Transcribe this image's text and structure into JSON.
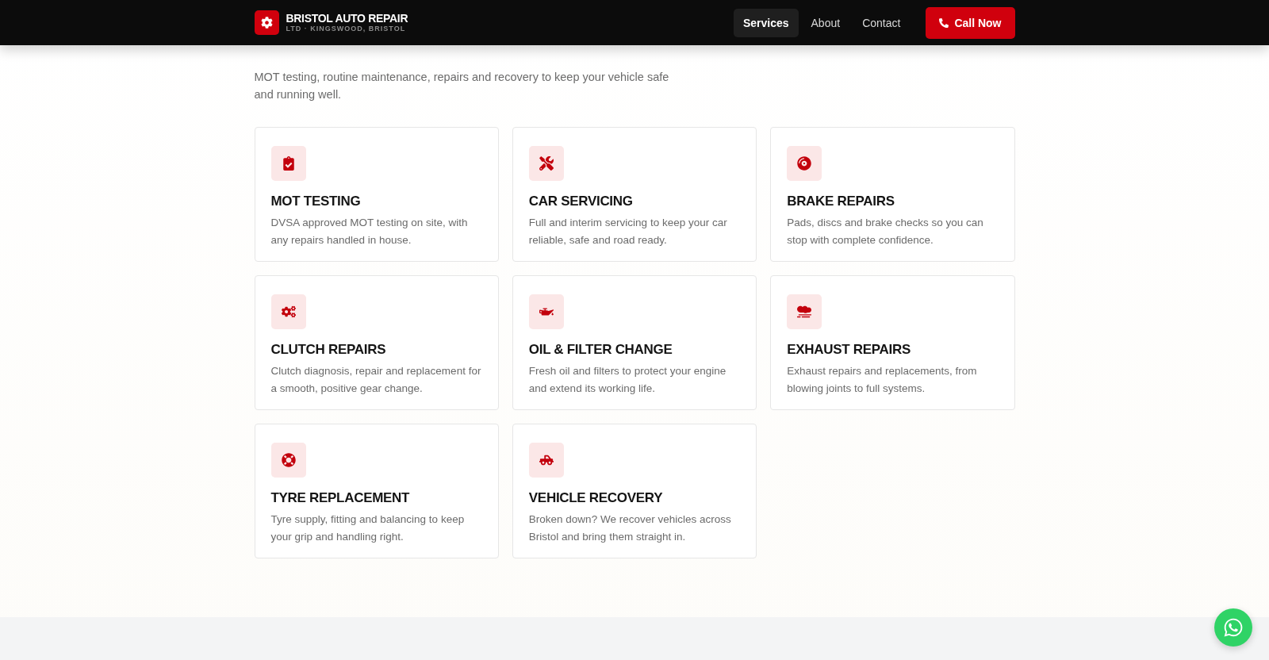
{
  "header": {
    "brand": {
      "name": "BRISTOL AUTO REPAIR",
      "tagline": "LTD · KINGSWOOD, BRISTOL"
    },
    "nav": [
      {
        "label": "Services",
        "selected": true
      },
      {
        "label": "About",
        "selected": false
      },
      {
        "label": "Contact",
        "selected": false
      }
    ],
    "cta": {
      "label": "Call Now"
    }
  },
  "section": {
    "intro": "MOT testing, routine maintenance, repairs and recovery to keep your vehicle safe and running well.",
    "services": [
      {
        "title": "MOT TESTING",
        "text": "DVSA approved MOT testing on site, with any repairs handled in house."
      },
      {
        "title": "CAR SERVICING",
        "text": "Full and interim servicing to keep your car reliable, safe and road ready."
      },
      {
        "title": "BRAKE REPAIRS",
        "text": "Pads, discs and brake checks so you can stop with complete confidence."
      },
      {
        "title": "CLUTCH REPAIRS",
        "text": "Clutch diagnosis, repair and replacement for a smooth, positive gear change."
      },
      {
        "title": "OIL & FILTER CHANGE",
        "text": "Fresh oil and filters to protect your engine and extend its working life."
      },
      {
        "title": "EXHAUST REPAIRS",
        "text": "Exhaust repairs and replacements, from blowing joints to full systems."
      },
      {
        "title": "TYRE REPLACEMENT",
        "text": "Tyre supply, fitting and balancing to keep your grip and handling right."
      },
      {
        "title": "VEHICLE RECOVERY",
        "text": "Broken down? We recover vehicles across Bristol and bring them straight in."
      }
    ]
  }
}
